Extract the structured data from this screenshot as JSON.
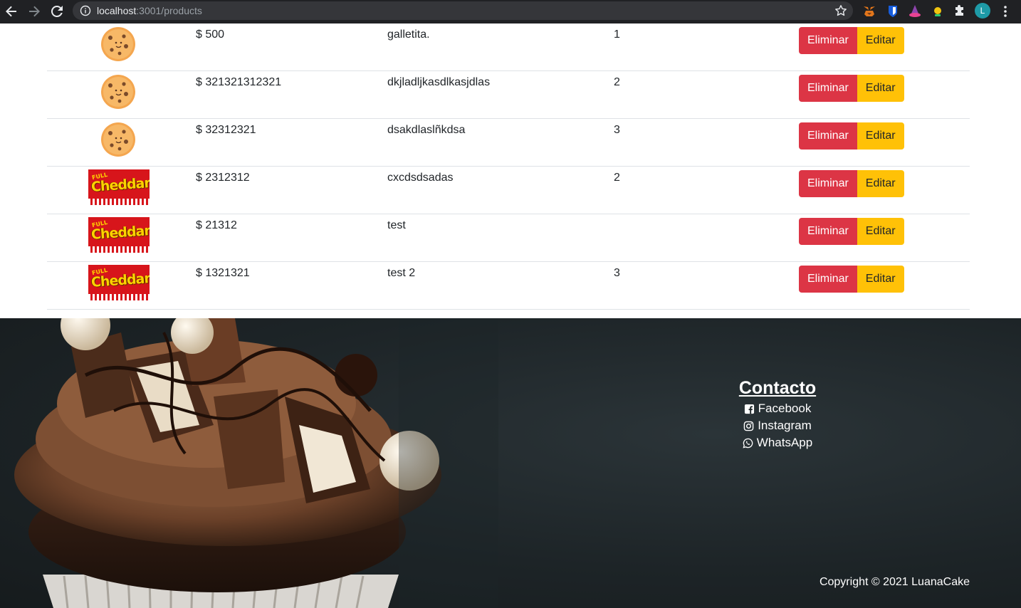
{
  "browser": {
    "url_host": "localhost",
    "url_path": ":3001/products",
    "profile_initial": "L"
  },
  "products": [
    {
      "image": "cookie",
      "price": "$ 500",
      "name": "galletita.",
      "quantity": "1"
    },
    {
      "image": "cookie",
      "price": "$ 321321312321",
      "name": "dkjladljkasdlkasjdlas",
      "quantity": "2"
    },
    {
      "image": "cookie",
      "price": "$ 32312321",
      "name": "dsakdlaslñkdsa",
      "quantity": "3"
    },
    {
      "image": "cheddar",
      "price": "$ 2312312",
      "name": "cxcdsdsadas",
      "quantity": "2"
    },
    {
      "image": "cheddar",
      "price": "$ 21312",
      "name": "test",
      "quantity": ""
    },
    {
      "image": "cheddar",
      "price": "$ 1321321",
      "name": "test 2",
      "quantity": "3"
    }
  ],
  "actions": {
    "delete_label": "Eliminar",
    "edit_label": "Editar"
  },
  "product_art": {
    "full_text": "FULL",
    "cheddar_text": "Cheddar"
  },
  "colors": {
    "delete": "#dc3545",
    "edit": "#ffc107",
    "chrome": "#202124"
  },
  "footer": {
    "contact_title": "Contacto",
    "links": [
      {
        "label": "Facebook",
        "icon": "facebook-square-icon"
      },
      {
        "label": "Instagram",
        "icon": "instagram-icon"
      },
      {
        "label": "WhatsApp",
        "icon": "whatsapp-icon"
      }
    ],
    "copyright": "Copyright © 2021 LuanaCake"
  }
}
